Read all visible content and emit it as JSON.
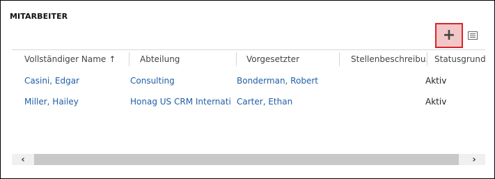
{
  "section": {
    "title": "MITARBEITER"
  },
  "toolbar": {
    "add_label": "+",
    "add_icon": "plus-icon",
    "view_icon": "list-view-icon"
  },
  "grid": {
    "columns": [
      {
        "label": "Vollständiger Name",
        "sort": "asc"
      },
      {
        "label": "Abteilung"
      },
      {
        "label": "Vorgesetzter"
      },
      {
        "label": "Stellenbeschreibu..."
      },
      {
        "label": "Statusgrund"
      }
    ],
    "rows": [
      {
        "name": "Casini, Edgar",
        "department": "Consulting",
        "manager": "Bonderman, Robert",
        "job": "",
        "status": "Aktiv"
      },
      {
        "name": "Miller, Hailey",
        "department": "Honag US CRM Internati...",
        "manager": "Carter, Ethan",
        "job": "",
        "status": "Aktiv"
      }
    ],
    "sort_arrow": "↑"
  },
  "scrollbar": {
    "left_arrow": "‹",
    "right_arrow": "›"
  },
  "colors": {
    "link": "#1f5ea8",
    "highlight_border": "#d9242b",
    "highlight_fill": "#f3c7c7"
  }
}
